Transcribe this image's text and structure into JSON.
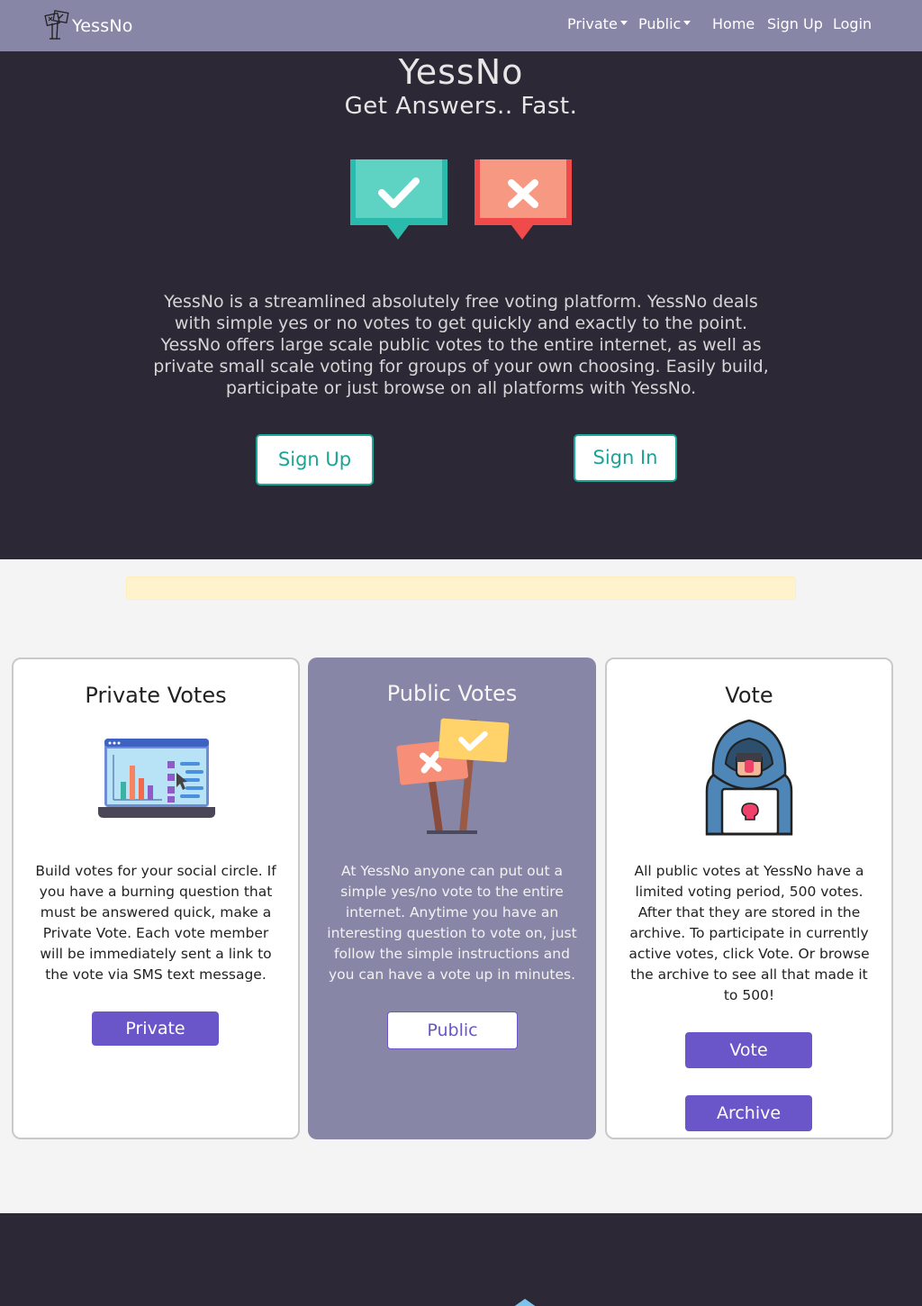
{
  "nav": {
    "brand": "YessNo",
    "items": [
      {
        "label": "Private",
        "dropdown": true
      },
      {
        "label": "Public",
        "dropdown": true
      },
      {
        "label": "Home",
        "dropdown": false
      },
      {
        "label": "Sign Up",
        "dropdown": false
      },
      {
        "label": "Login",
        "dropdown": false
      }
    ]
  },
  "hero": {
    "title": "YessNo",
    "subtitle": "Get Answers.. Fast.",
    "icons": [
      "check-bubble-icon",
      "x-bubble-icon"
    ],
    "description": "YessNo is a streamlined absolutely free voting platform. YessNo deals with simple yes or no votes to get quickly and exactly to the point. YessNo offers large scale public votes to the entire internet, as well as private small scale voting for groups of your own choosing. Easily build, participate or just browse on all platforms with YessNo.",
    "signup_label": "Sign Up",
    "signin_label": "Sign In"
  },
  "cards": [
    {
      "title": "Private Votes",
      "icon": "laptop-chart-icon",
      "text": "Build votes for your social circle. If you have a burning question that must be answered quick, make a Private Vote. Each vote member will be immediately sent a link to the vote via SMS text message.",
      "button_label": "Private"
    },
    {
      "title": "Public Votes",
      "icon": "vote-signs-icon",
      "text": "At YessNo anyone can put out a simple yes/no vote to the entire internet. Anytime you have an interesting question to vote on, just follow the simple instructions and you can have a vote up in minutes.",
      "button_label": "Public"
    },
    {
      "title": "Vote",
      "icon": "hooded-voter-icon",
      "text": "All public votes at YessNo have a limited voting period, 500 votes. After that they are stored in the archive. To participate in currently active votes, click Vote. Or browse the archive to see all that made it to 500!",
      "vote_label": "Vote",
      "archive_label": "Archive"
    }
  ],
  "colors": {
    "navbar": "#8886a6",
    "hero_bg": "#2d2835",
    "teal": "#19a89a",
    "purple": "#6a56c9",
    "alert": "#fff3cd"
  }
}
